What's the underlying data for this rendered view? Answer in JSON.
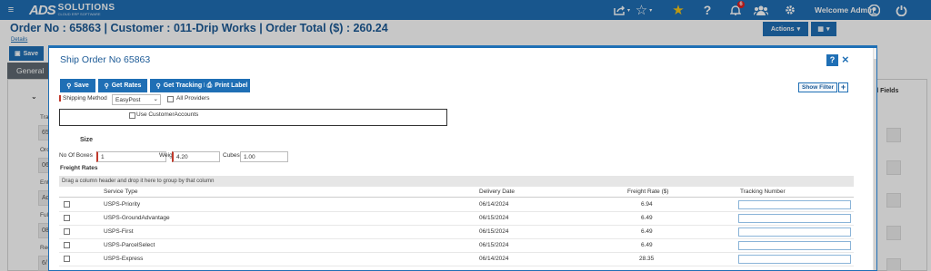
{
  "brand": {
    "logo_mark": "ADS",
    "logo_word": "SOLUTIONS",
    "logo_sub": "CLOUD ERP SOFTWARE"
  },
  "topbar": {
    "welcome": "Welcome Admin",
    "notification_count": "6"
  },
  "page": {
    "title": "Order No  : 65863 | Customer : 011-Drip Works | Order Total ($) : 260.24",
    "details_link": "Details",
    "actions_label": "Actions",
    "save_label": "Save",
    "general_tab": "General",
    "advanced_fields": "ed Fields",
    "bg_labels": [
      "Trans",
      "Orde",
      "Enter",
      "Fulfill",
      "Requ"
    ],
    "bg_values": [
      "658",
      "06/",
      "Adr",
      "08",
      "6/"
    ]
  },
  "modal": {
    "title": "Ship Order No 65863",
    "help_label": "?",
    "close_label": "×",
    "toolbar": {
      "save": "Save",
      "get_rates": "Get Rates",
      "get_tracking": "Get Tracking No",
      "print_label": "Print Label"
    },
    "shipping_method_label": "Shipping Method",
    "shipping_method_value": "EasyPost",
    "all_providers_label": "All Providers",
    "use_customer_accounts": "Use CustomerAccounts",
    "size_heading": "Size",
    "boxes_label": "No Of Boxes",
    "boxes_value": "1",
    "weight_label": "Weight",
    "weight_value": "4.20",
    "cubes_label": "Cubes",
    "cubes_value": "1.00",
    "freight_heading": "Freight Rates",
    "show_filter": "Show Filter",
    "show_filter_plus": "+",
    "group_hint": "Drag a column header and drop it here to group by that column",
    "columns": {
      "service": "Service Type",
      "delivery": "Delivery Date",
      "rate": "Freight Rate ($)",
      "tracking": "Tracking Number"
    },
    "rows": [
      {
        "service": "USPS-Priority",
        "delivery": "06/14/2024",
        "rate": "6.94"
      },
      {
        "service": "USPS-GroundAdvantage",
        "delivery": "06/15/2024",
        "rate": "6.49"
      },
      {
        "service": "USPS-First",
        "delivery": "06/15/2024",
        "rate": "6.49"
      },
      {
        "service": "USPS-ParcelSelect",
        "delivery": "06/15/2024",
        "rate": "6.49"
      },
      {
        "service": "USPS-Express",
        "delivery": "06/14/2024",
        "rate": "28.35"
      }
    ]
  },
  "colors": {
    "primary": "#1f6fb5",
    "title": "#1c5a96",
    "star": "#f5c518",
    "badge": "#e02020"
  }
}
